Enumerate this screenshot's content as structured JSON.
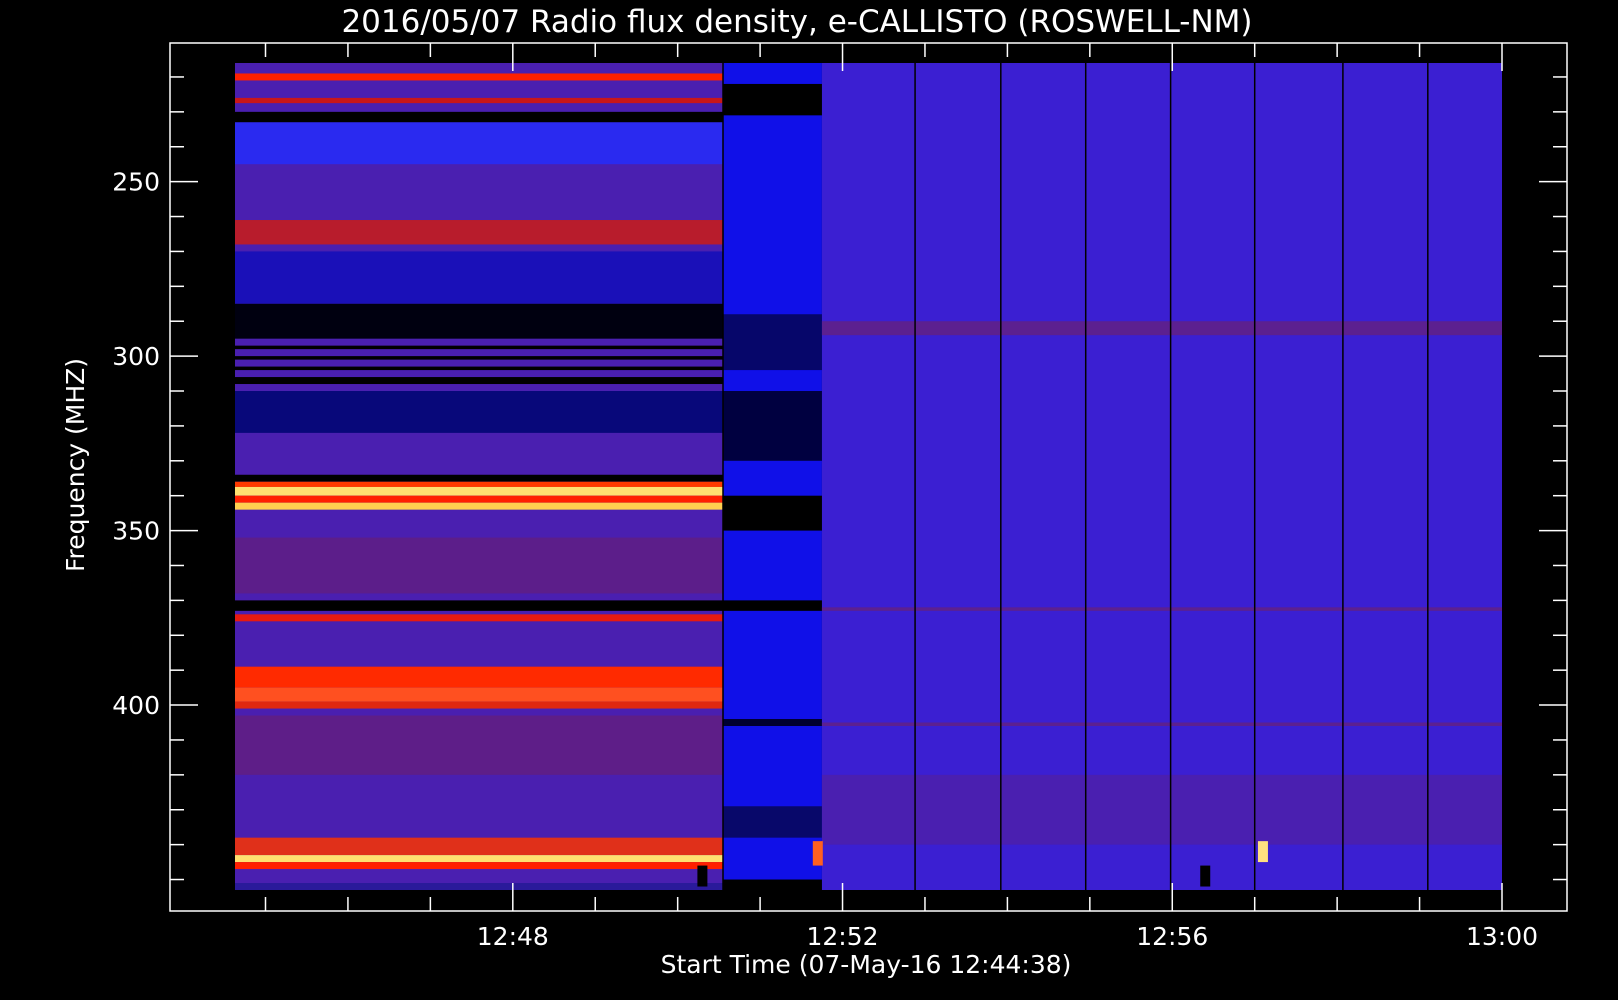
{
  "chart_data": {
    "type": "heatmap",
    "title": "2016/05/07  Radio flux density, e-CALLISTO (ROSWELL-NM)",
    "xlabel": "Start Time (07-May-16 12:44:38)",
    "ylabel": "Frequency (MHZ)",
    "x_ticks": [
      "12:48",
      "12:52",
      "12:56",
      "13:00"
    ],
    "x_tick_values_min": [
      48,
      52,
      56,
      60
    ],
    "x_range_min": [
      44.63,
      60
    ],
    "y_ticks": [
      250,
      300,
      350,
      400
    ],
    "y_range": [
      216,
      453
    ],
    "y_inverted": true,
    "colorscale": [
      "#000000",
      "#0000ff",
      "#5a1e8c",
      "#ff2000",
      "#ffff60"
    ],
    "segments": [
      {
        "start_min": 44.63,
        "end_min": 50.55,
        "background": "#4a1fb0"
      },
      {
        "start_min": 50.55,
        "end_min": 51.75,
        "background": "#1010e8"
      },
      {
        "start_min": 51.75,
        "end_min": 60.0,
        "background": "#3b1fd2"
      }
    ],
    "bands": [
      {
        "segment": 0,
        "from_mhz": 219,
        "to_mhz": 221,
        "color": "#ff2000"
      },
      {
        "segment": 0,
        "from_mhz": 226,
        "to_mhz": 227.5,
        "color": "#c8161a"
      },
      {
        "segment": 0,
        "from_mhz": 230,
        "to_mhz": 233,
        "color": "#000000"
      },
      {
        "segment": 0,
        "from_mhz": 233,
        "to_mhz": 245,
        "color": "#2a2af0"
      },
      {
        "segment": 0,
        "from_mhz": 261,
        "to_mhz": 268,
        "color": "#b81c2c"
      },
      {
        "segment": 0,
        "from_mhz": 270,
        "to_mhz": 285,
        "color": "#1a10b8"
      },
      {
        "segment": 0,
        "from_mhz": 285,
        "to_mhz": 295,
        "color": "#000010"
      },
      {
        "segment": 0,
        "from_mhz": 297,
        "to_mhz": 298,
        "color": "#000000"
      },
      {
        "segment": 0,
        "from_mhz": 300,
        "to_mhz": 301,
        "color": "#000000"
      },
      {
        "segment": 0,
        "from_mhz": 303,
        "to_mhz": 304,
        "color": "#000000"
      },
      {
        "segment": 0,
        "from_mhz": 306,
        "to_mhz": 308,
        "color": "#000000"
      },
      {
        "segment": 0,
        "from_mhz": 310,
        "to_mhz": 322,
        "color": "#08087a"
      },
      {
        "segment": 0,
        "from_mhz": 334,
        "to_mhz": 336,
        "color": "#000000"
      },
      {
        "segment": 0,
        "from_mhz": 336,
        "to_mhz": 337.5,
        "color": "#ff3a00"
      },
      {
        "segment": 0,
        "from_mhz": 337.5,
        "to_mhz": 340,
        "color": "#ffe070"
      },
      {
        "segment": 0,
        "from_mhz": 340,
        "to_mhz": 342,
        "color": "#ff2000"
      },
      {
        "segment": 0,
        "from_mhz": 342,
        "to_mhz": 344,
        "color": "#ffd050"
      },
      {
        "segment": 0,
        "from_mhz": 352,
        "to_mhz": 368,
        "color": "#5c1e8a"
      },
      {
        "segment": 0,
        "from_mhz": 370,
        "to_mhz": 373,
        "color": "#000000"
      },
      {
        "segment": 0,
        "from_mhz": 374,
        "to_mhz": 376,
        "color": "#e81a10"
      },
      {
        "segment": 0,
        "from_mhz": 389,
        "to_mhz": 395,
        "color": "#ff2a00"
      },
      {
        "segment": 0,
        "from_mhz": 395,
        "to_mhz": 399,
        "color": "#ff5020"
      },
      {
        "segment": 0,
        "from_mhz": 399,
        "to_mhz": 401,
        "color": "#e02810"
      },
      {
        "segment": 0,
        "from_mhz": 403,
        "to_mhz": 420,
        "color": "#5e1e88"
      },
      {
        "segment": 0,
        "from_mhz": 438,
        "to_mhz": 443,
        "color": "#e0301a"
      },
      {
        "segment": 0,
        "from_mhz": 443,
        "to_mhz": 445,
        "color": "#ffe070"
      },
      {
        "segment": 0,
        "from_mhz": 445,
        "to_mhz": 447,
        "color": "#ff2000"
      },
      {
        "segment": 0,
        "from_mhz": 451,
        "to_mhz": 453,
        "color": "#2a1a9a"
      },
      {
        "segment": 1,
        "from_mhz": 222,
        "to_mhz": 231,
        "color": "#000000"
      },
      {
        "segment": 1,
        "from_mhz": 288,
        "to_mhz": 304,
        "color": "#06066a"
      },
      {
        "segment": 1,
        "from_mhz": 310,
        "to_mhz": 330,
        "color": "#000040"
      },
      {
        "segment": 1,
        "from_mhz": 340,
        "to_mhz": 350,
        "color": "#000000"
      },
      {
        "segment": 1,
        "from_mhz": 370,
        "to_mhz": 373,
        "color": "#000000"
      },
      {
        "segment": 1,
        "from_mhz": 404,
        "to_mhz": 406,
        "color": "#000030"
      },
      {
        "segment": 1,
        "from_mhz": 429,
        "to_mhz": 438,
        "color": "#08086a"
      },
      {
        "segment": 1,
        "from_mhz": 450,
        "to_mhz": 453,
        "color": "#000000"
      },
      {
        "segment": 2,
        "from_mhz": 290,
        "to_mhz": 294,
        "color": "#5c2090"
      },
      {
        "segment": 2,
        "from_mhz": 372,
        "to_mhz": 373,
        "color": "#5c2090"
      },
      {
        "segment": 2,
        "from_mhz": 405,
        "to_mhz": 406,
        "color": "#5c2090"
      },
      {
        "segment": 2,
        "from_mhz": 420,
        "to_mhz": 440,
        "color": "#4a1fb0"
      }
    ],
    "vertical_lines_min": [
      50.55,
      52.88,
      53.92,
      54.95,
      55.98,
      57.0,
      58.07,
      59.1
    ],
    "spots": [
      {
        "t_min": 51.7,
        "from_mhz": 439,
        "to_mhz": 446,
        "color": "#ff6020"
      },
      {
        "t_min": 57.1,
        "from_mhz": 439,
        "to_mhz": 445,
        "color": "#ffe080"
      },
      {
        "t_min": 56.4,
        "from_mhz": 446,
        "to_mhz": 452,
        "color": "#000000"
      },
      {
        "t_min": 50.3,
        "from_mhz": 446,
        "to_mhz": 452,
        "color": "#000000"
      }
    ]
  }
}
